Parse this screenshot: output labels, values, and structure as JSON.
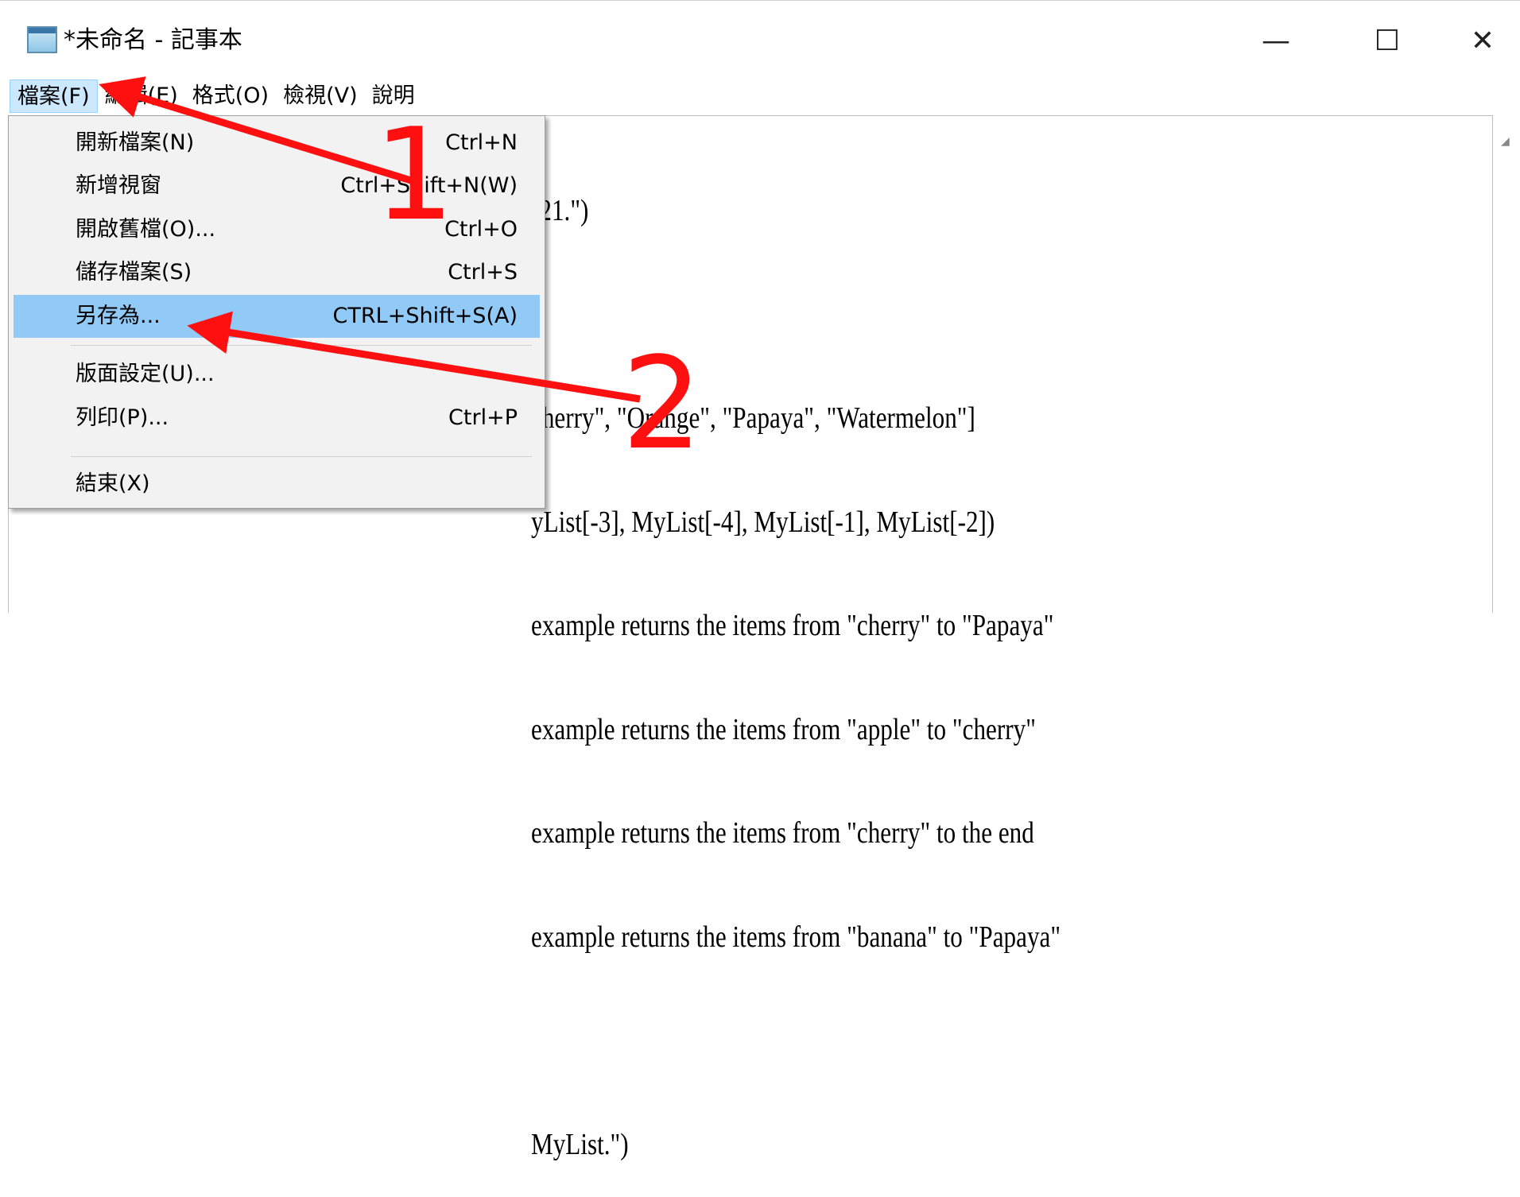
{
  "window": {
    "title": "*未命名 - 記事本",
    "minimize_glyph": "—",
    "maximize_glyph": "☐",
    "close_glyph": "✕"
  },
  "menubar": {
    "items": [
      {
        "label": "檔案(F)"
      },
      {
        "label": "編輯(E)"
      },
      {
        "label": "格式(O)"
      },
      {
        "label": "檢視(V)"
      },
      {
        "label": "說明"
      }
    ]
  },
  "file_menu": {
    "items": [
      {
        "label": "開新檔案(N)",
        "shortcut": "Ctrl+N"
      },
      {
        "label": "新增視窗",
        "shortcut": "Ctrl+Shift+N(W)"
      },
      {
        "label": "開啟舊檔(O)...",
        "shortcut": "Ctrl+O"
      },
      {
        "label": "儲存檔案(S)",
        "shortcut": "Ctrl+S"
      },
      {
        "label": "另存為...",
        "shortcut": "CTRL+Shift+S(A)"
      },
      {
        "label": "版面設定(U)...",
        "shortcut": ""
      },
      {
        "label": "列印(P)...",
        "shortcut": "Ctrl+P"
      },
      {
        "label": "結束(X)",
        "shortcut": ""
      }
    ]
  },
  "editor": {
    "lines": [
      ")21.\")",
      "",
      "cherry\", \"Orange\", \"Papaya\", \"Watermelon\"]",
      "yList[-3], MyList[-4], MyList[-1], MyList[-2])",
      "example returns the items from \"cherry\" to \"Papaya\"",
      "example returns the items from \"apple\" to \"cherry\"",
      "example returns the items from \"cherry\" to the end",
      "example returns the items from \"banana\" to \"Papaya\"",
      "",
      "MyList.\")"
    ]
  },
  "annotations": {
    "step1": "1",
    "step2": "2",
    "color": "#ff1010"
  },
  "colors": {
    "highlight": "#91c9f7",
    "menu_active": "#cce8ff"
  }
}
